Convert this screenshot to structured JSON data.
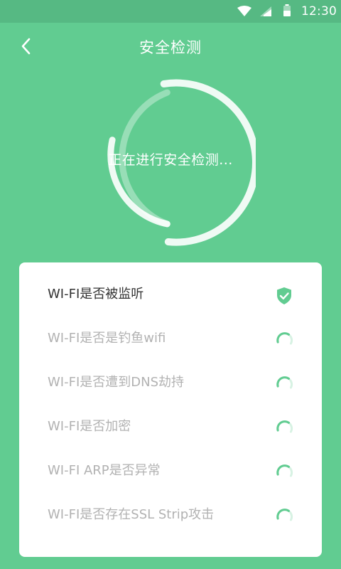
{
  "status_bar": {
    "time": "12:30",
    "icons": [
      "wifi-icon",
      "signal-icon",
      "battery-icon"
    ]
  },
  "header": {
    "title": "安全检测",
    "back_icon": "chevron-left-icon"
  },
  "scan": {
    "status_text": "正在进行安全检测..."
  },
  "checks": [
    {
      "label": "WI-FI是否被监听",
      "state": "done",
      "icon": "shield-check-icon"
    },
    {
      "label": "WI-FI是否是钓鱼wifi",
      "state": "scanning",
      "icon": "spinner-icon"
    },
    {
      "label": "WI-FI是否遭到DNS劫持",
      "state": "scanning",
      "icon": "spinner-icon"
    },
    {
      "label": "WI-FI是否加密",
      "state": "scanning",
      "icon": "spinner-icon"
    },
    {
      "label": "WI-FI ARP是否异常",
      "state": "scanning",
      "icon": "spinner-icon"
    },
    {
      "label": "WI-FI是否存在SSL Strip攻击",
      "state": "scanning",
      "icon": "spinner-icon"
    }
  ],
  "colors": {
    "background": "#61cc91",
    "status_bar": "#56b983",
    "card": "#ffffff",
    "done_text": "#333333",
    "pending_text": "#b2b2b2",
    "accent": "#61cc91"
  }
}
